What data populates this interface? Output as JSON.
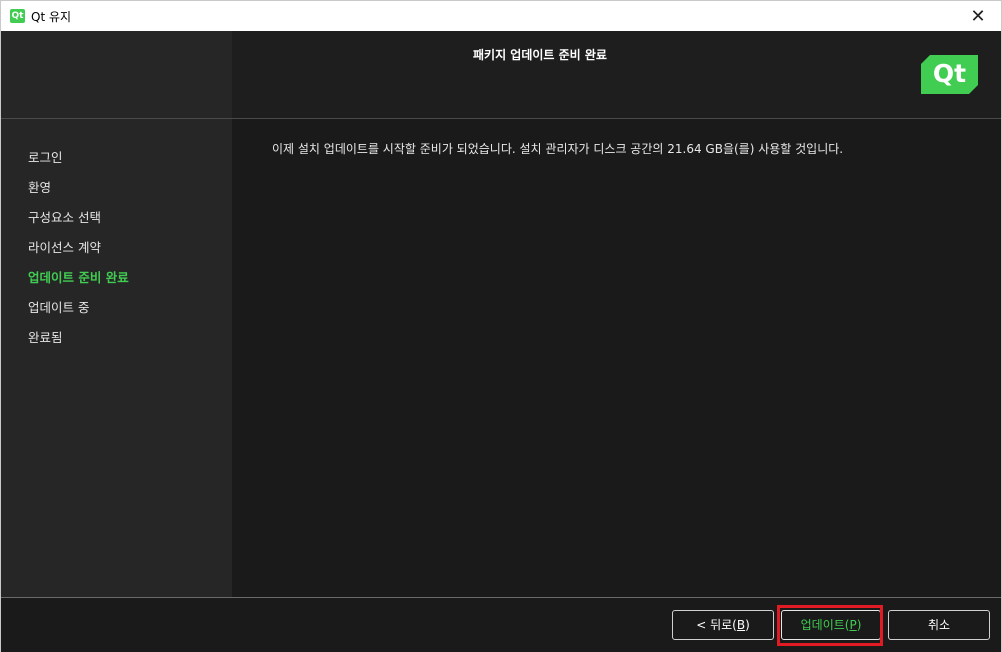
{
  "window": {
    "app_icon_text": "Qt",
    "title": "Qt 유지",
    "close_glyph": "✕"
  },
  "header": {
    "page_title": "패키지 업데이트 준비 완료",
    "logo_text": "Qt"
  },
  "steps": [
    {
      "label": "로그인",
      "active": false
    },
    {
      "label": "환영",
      "active": false
    },
    {
      "label": "구성요소 선택",
      "active": false
    },
    {
      "label": "라이선스 계약",
      "active": false
    },
    {
      "label": "업데이트 준비 완료",
      "active": true
    },
    {
      "label": "업데이트 중",
      "active": false
    },
    {
      "label": "완료됨",
      "active": false
    }
  ],
  "content": {
    "message": "이제 설치 업데이트를 시작할 준비가 되었습니다. 설치 관리자가 디스크 공간의 21.64 GB을(를) 사용할 것입니다."
  },
  "footer": {
    "back_prefix": "< 뒤로(",
    "back_key": "B",
    "back_suffix": ")",
    "update_prefix": "업데이트(",
    "update_key": "P",
    "update_suffix": ")",
    "cancel_label": "취소"
  },
  "colors": {
    "accent": "#41cd52",
    "highlight": "#e01b24",
    "background": "#1a1a1a",
    "sidebar": "#262626"
  },
  "icons": {
    "app": "qt-logo-icon",
    "close": "close-icon"
  }
}
